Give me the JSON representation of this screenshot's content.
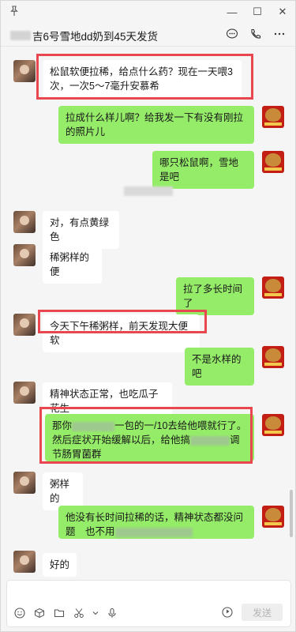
{
  "window": {
    "title": "吉6号雪地dd奶到45天发货",
    "controls": {
      "minimize": "—",
      "maximize": "☐",
      "close": "✕"
    }
  },
  "messages": [
    {
      "side": "left",
      "text": "松鼠软便拉稀，给点什么药？现在一天喂3次，一次5～7毫升安慕希",
      "highlighted": true
    },
    {
      "side": "right",
      "text": "拉成什么样儿啊？给我发一下有没有刚拉的照片儿"
    },
    {
      "side": "right",
      "text": "哪只松鼠啊，雪地是吧"
    },
    {
      "side": "left",
      "text": "对，有点黄绿色"
    },
    {
      "side": "left",
      "text": "稀粥样的便"
    },
    {
      "side": "right",
      "text": "拉了多长时间了"
    },
    {
      "side": "left",
      "text": "今天下午稀粥样，前天发现大便软",
      "highlighted": true
    },
    {
      "side": "right",
      "text": "不是水样的 吧"
    },
    {
      "side": "left",
      "text": "精神状态正常，也吃瓜子花生"
    },
    {
      "side": "right",
      "highlighted": true,
      "parts": [
        "那你",
        "一包的一/10去给他喂就行了。然后症状开始缓解以后，给他搞",
        "调节肠胃菌群"
      ]
    },
    {
      "side": "left",
      "text": "粥样的"
    },
    {
      "side": "right",
      "parts": [
        "他没有长时间拉稀的话，精神状态都没问题　也不用"
      ]
    },
    {
      "side": "left",
      "text": "好的"
    }
  ],
  "input": {
    "send_label": "发送",
    "tools": [
      "emoji-icon",
      "box-icon",
      "folder-icon",
      "scissors-icon",
      "chevron-down-icon",
      "mic-icon"
    ]
  },
  "colors": {
    "bubble_self": "#95ec69",
    "bubble_other": "#ffffff",
    "highlight_box": "#e8474f",
    "background": "#f5f5f5"
  }
}
